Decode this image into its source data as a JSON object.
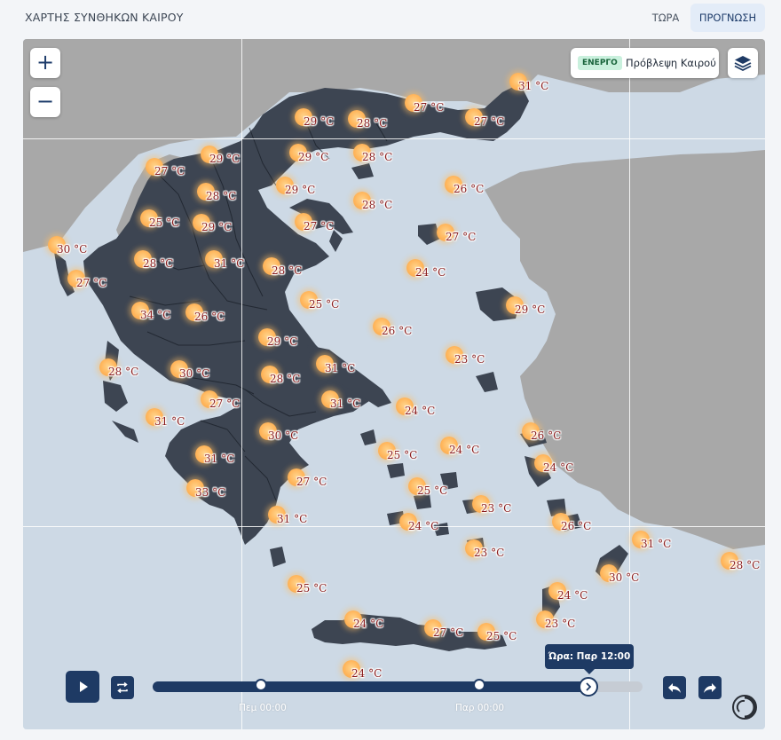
{
  "header": {
    "title": "ΧΑΡΤΗΣ ΣΥΝΘΗΚΩΝ ΚΑΙΡΟΥ",
    "tabs": [
      {
        "label": "ΤΩΡΑ",
        "active": false
      },
      {
        "label": "ΠΡΟΓΝΩΣΗ",
        "active": true
      }
    ]
  },
  "map": {
    "zoom_in_label": "+",
    "zoom_out_label": "−",
    "layer": {
      "status_badge": "ΕΝΕΡΓΟ",
      "name": "Πρόβλεψη Καιρού"
    },
    "layers_icon": "layers-icon",
    "weather_icon": "sun-icon",
    "colors": {
      "sea": "#cdd9e5",
      "land_greece": "#3d4552",
      "land_other": "#a9a9a9",
      "accent": "#1e3a64"
    },
    "temperatures": [
      "31 °C",
      "27 °C",
      "27 °C",
      "29 °C",
      "28 °C",
      "29 °C",
      "27 °C",
      "29 °C",
      "28 °C",
      "28 °C",
      "29 °C",
      "28 °C",
      "26 °C",
      "25 °C",
      "29 °C",
      "27 °C",
      "30 °C",
      "28 °C",
      "31 °C",
      "28 °C",
      "27 °C",
      "27 °C",
      "24 °C",
      "25 °C",
      "34 °C",
      "26 °C",
      "29 °C",
      "26 °C",
      "29 °C",
      "23 °C",
      "28 °C",
      "30 °C",
      "31 °C",
      "28 °C",
      "27 °C",
      "31 °C",
      "31 °C",
      "24 °C",
      "26 °C",
      "30 °C",
      "24 °C",
      "31 °C",
      "25 °C",
      "24 °C",
      "27 °C",
      "33 °C",
      "25 °C",
      "23 °C",
      "24 °C",
      "26 °C",
      "31 °C",
      "31 °C",
      "23 °C",
      "30 °C",
      "28 °C",
      "25 °C",
      "24 °C",
      "24 °C",
      "27 °C",
      "25 °C",
      "23 °C",
      "24 °C"
    ]
  },
  "timeline": {
    "play_icon": "play-icon",
    "loop_icon": "repeat-icon",
    "tick_labels": [
      "Πεμ 00:00",
      "Παρ 00:00"
    ],
    "current_time": "Ώρα: Παρ 12:00",
    "progress": 0.89,
    "prev_icon": "rewind-icon",
    "next_icon": "forward-icon",
    "logo": "logo-mark"
  }
}
